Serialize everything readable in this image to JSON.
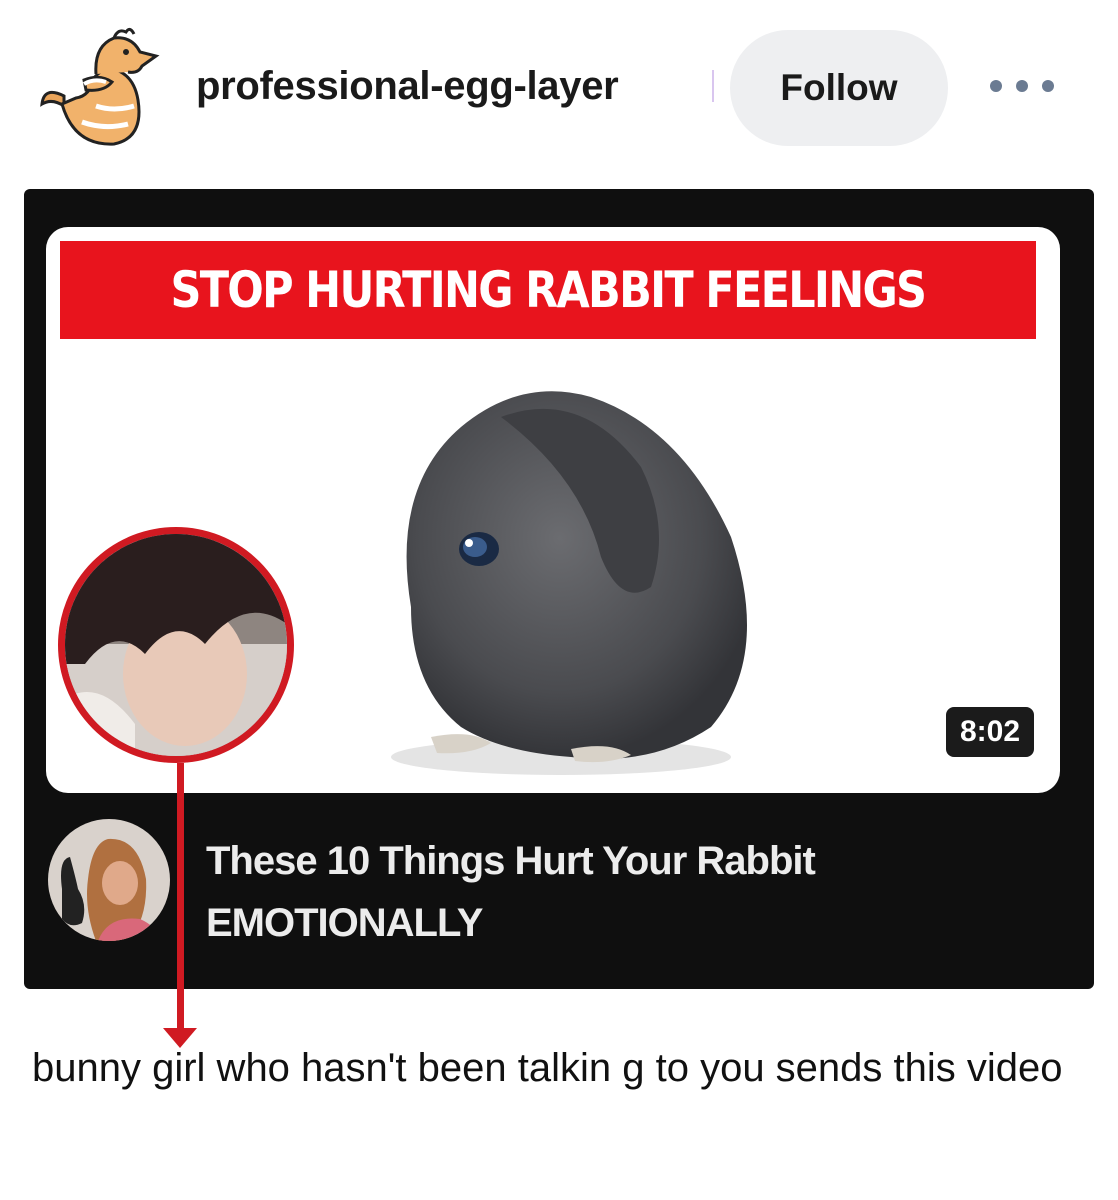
{
  "post": {
    "username": "professional-egg-layer",
    "follow_label": "Follow",
    "more_label": "More options"
  },
  "video": {
    "banner_text": "STOP HURTING RABBIT FEELINGS",
    "duration": "8:02",
    "title_line1": "These 10 Things Hurt Your Rabbit",
    "title_line2": "EMOTIONALLY"
  },
  "caption": "bunny girl who hasn't been talkin g to you sends this video",
  "colors": {
    "banner_red": "#e8141d",
    "highlight_red": "#d01a22",
    "follow_bg": "#eeeff1",
    "card_bg": "#0f0f0f"
  },
  "icons": {
    "avatar": "chicken-avatar-icon",
    "more": "ellipsis-icon"
  }
}
